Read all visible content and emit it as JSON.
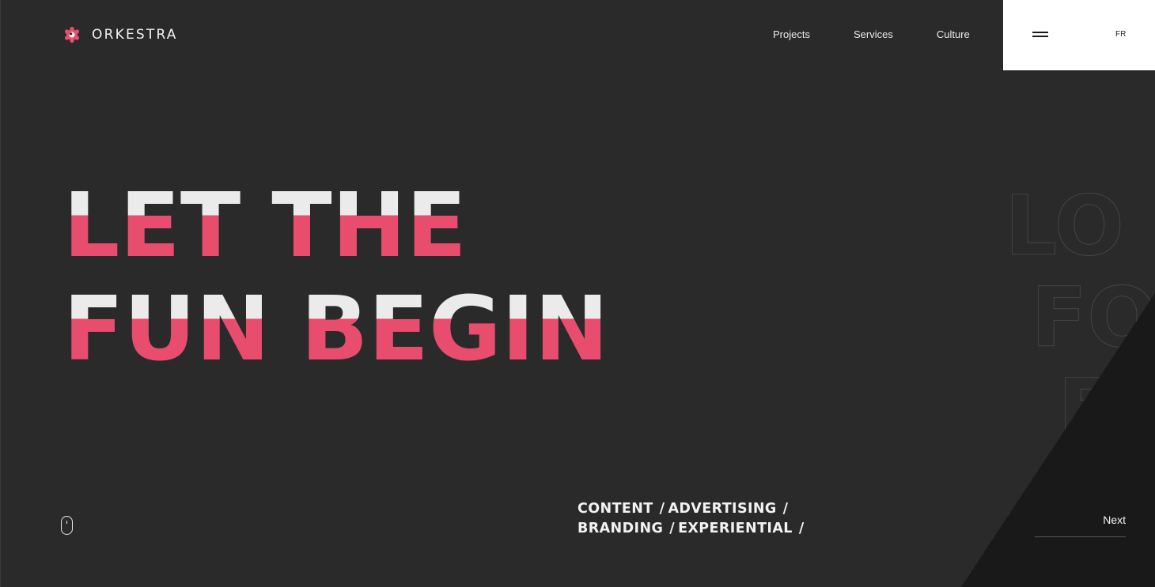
{
  "brand": {
    "name": "ORKESTRA",
    "logo_icon": "gear-flower-icon",
    "accent_color": "#e84d6e"
  },
  "nav": {
    "items": [
      {
        "label": "Projects"
      },
      {
        "label": "Services"
      },
      {
        "label": "Culture"
      }
    ],
    "menu_icon": "hamburger-icon",
    "language": "FR"
  },
  "hero": {
    "line1": "LET THE",
    "line2": "FUN BEGIN",
    "text_top_color": "#ebebeb",
    "text_bottom_color": "#e84d6e"
  },
  "ghost_text": {
    "line1": "LO",
    "line2": "FO",
    "line3": "F"
  },
  "services": {
    "row1": [
      "CONTENT",
      "ADVERTISING"
    ],
    "row2": [
      "BRANDING",
      "EXPERIENTIAL"
    ],
    "separator": "/"
  },
  "scroll_indicator": {
    "icon": "mouse-scroll-icon"
  },
  "next": {
    "label": "Next"
  },
  "colors": {
    "background": "#2a2a2b",
    "triangle": "#191919",
    "menu_panel": "#ffffff"
  }
}
